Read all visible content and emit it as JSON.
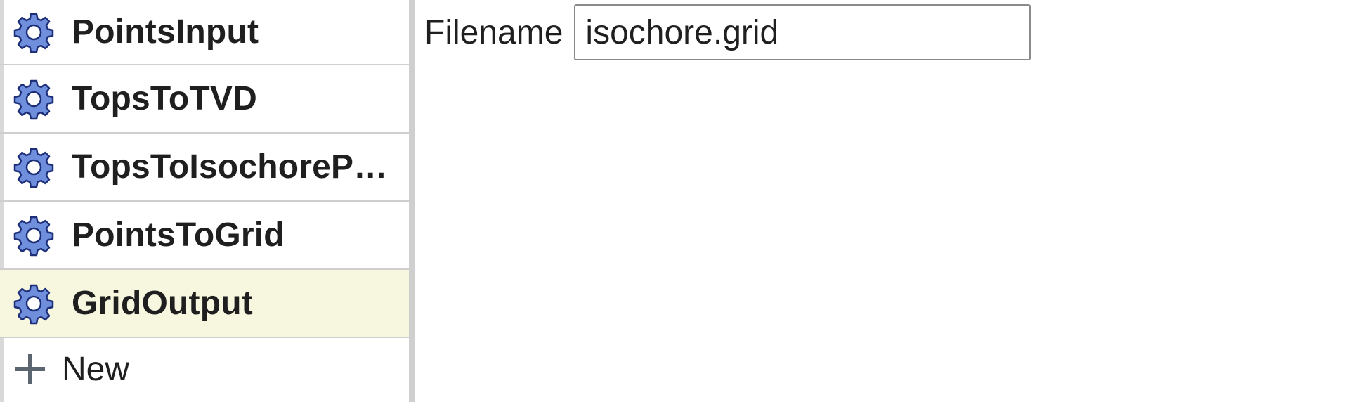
{
  "pipeline": {
    "steps": [
      {
        "label": "PointsInput",
        "icon": "gear-icon",
        "selected": false
      },
      {
        "label": "TopsToTVD",
        "icon": "gear-icon",
        "selected": false
      },
      {
        "label": "TopsToIsochoreP…",
        "icon": "gear-icon",
        "selected": false
      },
      {
        "label": "PointsToGrid",
        "icon": "gear-icon",
        "selected": false
      },
      {
        "label": "GridOutput",
        "icon": "gear-icon",
        "selected": true
      }
    ],
    "new_label": "New",
    "new_icon": "plus-icon"
  },
  "properties": {
    "filename_label": "Filename",
    "filename_value": "isochore.grid"
  },
  "colors": {
    "gear_fill": "#6f8fdc",
    "gear_stroke": "#1c2f78",
    "selected_bg": "#f7f7df",
    "divider": "#cfcfcf"
  }
}
